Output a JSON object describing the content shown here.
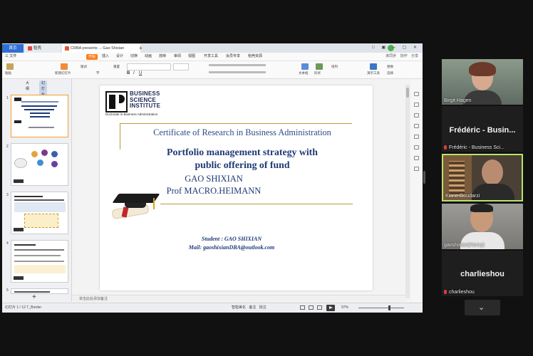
{
  "wps": {
    "tabs": {
      "home": "首页",
      "doc": "稻壳",
      "ppt": "CRBA presents ... Gao Shixian"
    },
    "window_controls": "□ ▣ ─ ▢ ✕",
    "menu": [
      "三 文件",
      "开始",
      "插入",
      "设计",
      "切换",
      "动画",
      "放映",
      "审阅",
      "视图",
      "开发工具",
      "会员专享",
      "稻壳资源"
    ],
    "menu_right": "未同步 协作 分享",
    "ribbon": [
      "粘贴",
      "新建幻灯片",
      "版式",
      "节",
      "重置",
      "文本框",
      "形状",
      "排列",
      "演示工具",
      "替换",
      "选择"
    ],
    "panel_tabs": [
      "大纲",
      "幻灯片"
    ],
    "slide_numbers": [
      "1",
      "2",
      "3",
      "4",
      "5"
    ],
    "notes_placeholder": "单击此处添加备注",
    "status_left": "幻灯片 1 / 12   T_Border",
    "status_right": "智能美化  备注  批注",
    "zoom": "97%"
  },
  "slide": {
    "logo_text": [
      "BUSINESS",
      "SCIENCE",
      "INSTITUTE"
    ],
    "logo_sub": "Doctorate in Business Administration",
    "cert_title": "Certificate of Research in Business Administration",
    "title_line1": "Portfolio management strategy with",
    "title_line2": "public offering of fund",
    "author1": "GAO SHIXIAN",
    "author2": "Prof MACRO.HEIMANN",
    "student": "Student : GAO SHIXIAN",
    "mail": "Mail: gaoshixianDBA@outlook.com"
  },
  "participants": [
    {
      "name": "Birgit Hagen",
      "big": ""
    },
    {
      "name": "Frédéric - Business Sci...",
      "big": "Frédéric - Busin..."
    },
    {
      "name": "Kiane Goudarzi",
      "big": ""
    },
    {
      "name": "gaoshixian(Henry)",
      "big": ""
    },
    {
      "name": "charlieshou",
      "big": "charlieshou"
    }
  ]
}
